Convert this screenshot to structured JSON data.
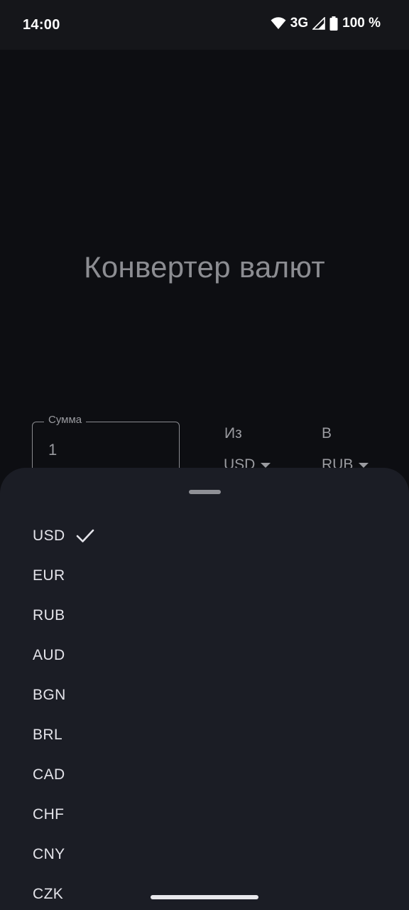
{
  "status_bar": {
    "time": "14:00",
    "network": "3G",
    "battery": "100 %",
    "icons": [
      "wifi-icon",
      "signal-icon",
      "battery-icon"
    ]
  },
  "main": {
    "title": "Конвертер валют",
    "amount": {
      "label": "Сумма",
      "value": "1"
    },
    "from": {
      "label": "Из",
      "value": "USD"
    },
    "to": {
      "label": "В",
      "value": "RUB"
    }
  },
  "sheet": {
    "selected": "USD",
    "options": [
      {
        "label": "USD"
      },
      {
        "label": "EUR"
      },
      {
        "label": "RUB"
      },
      {
        "label": "AUD"
      },
      {
        "label": "BGN"
      },
      {
        "label": "BRL"
      },
      {
        "label": "CAD"
      },
      {
        "label": "CHF"
      },
      {
        "label": "CNY"
      },
      {
        "label": "CZK"
      }
    ]
  },
  "colors": {
    "background": "#0d0e12",
    "sheet": "#1b1d25",
    "text_muted": "#9a9ba0",
    "text_primary": "#e4e4ea"
  }
}
